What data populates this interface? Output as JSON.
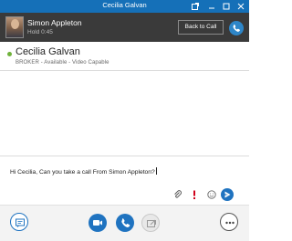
{
  "window": {
    "title": "Cecilia Galvan",
    "controls": [
      "popout-icon",
      "minimize-icon",
      "maximize-icon",
      "close-icon"
    ]
  },
  "call_bar": {
    "caller_name": "Simon Appleton",
    "hold_status": "Hold 0:45",
    "back_to_call_label": "Back to Call",
    "accent_color": "#2e86c8"
  },
  "contact": {
    "name": "Cecilia Galvan",
    "status_line": "BROKER - Available - Video Capable",
    "presence_color": "#6fb23b"
  },
  "compose": {
    "message_text": "Hi Cecilia, Can you take a call From Simon Appleton?",
    "tool_icons": [
      "attachment-icon",
      "importance-icon",
      "emoticon-icon",
      "send-icon"
    ]
  },
  "bottom_bar": {
    "buttons": [
      "im-icon",
      "video-icon",
      "phone-icon",
      "share-screen-icon",
      "more-options-icon"
    ],
    "accent_color": "#1f73c0"
  }
}
